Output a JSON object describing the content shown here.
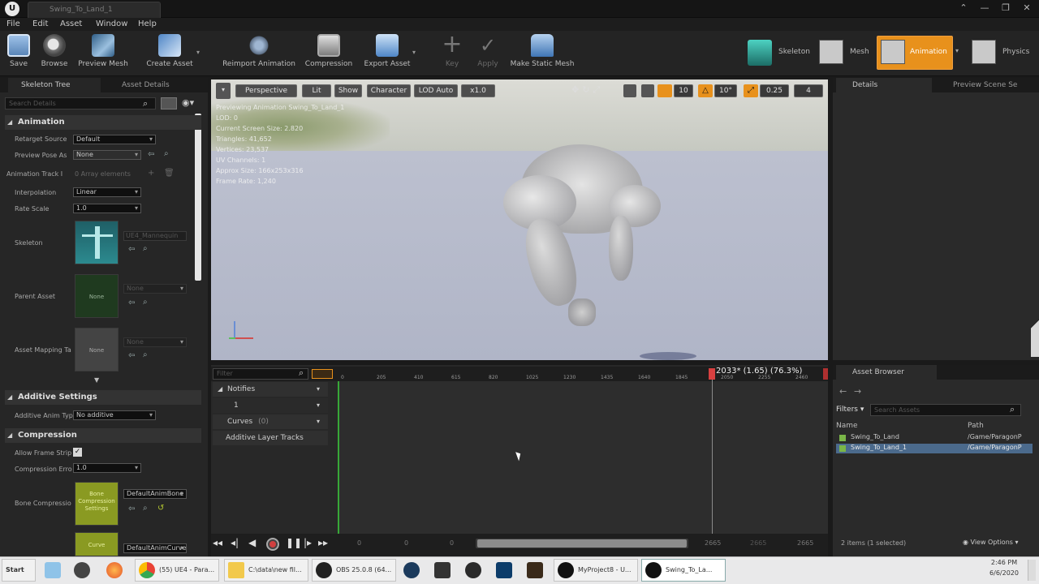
{
  "window": {
    "tab_title": "Swing_To_Land_1",
    "controls": [
      "⌃",
      "—",
      "❐",
      "✕"
    ]
  },
  "menu": [
    "File",
    "Edit",
    "Asset",
    "Window",
    "Help"
  ],
  "toolbar": {
    "buttons": [
      {
        "label": "Save",
        "icon": "save-icon"
      },
      {
        "label": "Browse",
        "icon": "browse-icon"
      },
      {
        "label": "Preview Mesh",
        "icon": "preview-mesh-icon"
      },
      {
        "label": "Create Asset",
        "icon": "create-asset-icon"
      },
      {
        "label": "Reimport Animation",
        "icon": "reimport-icon"
      },
      {
        "label": "Compression",
        "icon": "compression-icon"
      },
      {
        "label": "Export Asset",
        "icon": "export-icon"
      },
      {
        "label": "Key",
        "icon": "plus-icon"
      },
      {
        "label": "Apply",
        "icon": "check-icon"
      },
      {
        "label": "Make Static Mesh",
        "icon": "static-mesh-icon"
      }
    ],
    "modes": [
      "Skeleton",
      "Mesh",
      "Animation",
      "Physics"
    ]
  },
  "left_panel": {
    "tabs": [
      "Skeleton Tree",
      "Asset Details"
    ],
    "search_placeholder": "Search Details",
    "sections": {
      "animation": "Animation",
      "additive": "Additive Settings",
      "compression": "Compression"
    },
    "props": {
      "retarget_source": {
        "label": "Retarget Source",
        "value": "Default"
      },
      "preview_pose": {
        "label": "Preview Pose As",
        "value": "None"
      },
      "animation_track": {
        "label": "Animation Track I",
        "value": "0 Array elements"
      },
      "interpolation": {
        "label": "Interpolation",
        "value": "Linear"
      },
      "rate_scale": {
        "label": "Rate Scale",
        "value": "1.0"
      },
      "skeleton": {
        "label": "Skeleton",
        "value": "UE4_Mannequin"
      },
      "parent_asset": {
        "label": "Parent Asset",
        "value": "None",
        "thumb": "None"
      },
      "asset_mapping": {
        "label": "Asset Mapping Ta",
        "value": "None",
        "thumb": "None"
      },
      "additive_anim_type": {
        "label": "Additive Anim Typ",
        "value": "No additive"
      },
      "allow_frame_strip": {
        "label": "Allow Frame Strip",
        "checked": true
      },
      "compression_error": {
        "label": "Compression Erro",
        "value": "1.0"
      },
      "bone_compression": {
        "label": "Bone Compressio",
        "value": "DefaultAnimBone",
        "thumb": "Bone Compression Settings"
      },
      "curve": {
        "value": "DefaultAnimCurve",
        "thumb": "Curve"
      }
    }
  },
  "viewport": {
    "buttons": [
      "Perspective",
      "Lit",
      "Show",
      "Character",
      "LOD Auto",
      "x1.0"
    ],
    "snap_values": [
      "10",
      "10°",
      "0.25",
      "4"
    ],
    "stats": [
      "Previewing Animation Swing_To_Land_1",
      "LOD: 0",
      "Current Screen Size: 2.820",
      "Triangles: 41,652",
      "Vertices: 23,537",
      "UV Channels: 1",
      "Approx Size: 166x253x316",
      "Frame Rate: 1,240"
    ]
  },
  "timeline": {
    "filter_placeholder": "Filter",
    "tracks": [
      "Notifies",
      "1",
      "Curves",
      "Additive Layer Tracks"
    ],
    "curves_count": "(0)",
    "ticks": [
      "0",
      "205",
      "410",
      "615",
      "820",
      "1025",
      "1230",
      "1435",
      "1640",
      "1845",
      "2050",
      "2255",
      "2460"
    ],
    "playhead_readout": "2033* (1.65) (76.3%)",
    "playback_fraction": 0.763,
    "range": [
      "0",
      "0",
      "0",
      "2665",
      "2665",
      "2665"
    ]
  },
  "right_panel": {
    "tabs": [
      "Details",
      "Preview Scene Se"
    ]
  },
  "asset_browser": {
    "tab": "Asset Browser",
    "filters_label": "Filters",
    "search_placeholder": "Search Assets",
    "columns": [
      "Name",
      "Path"
    ],
    "rows": [
      {
        "name": "Swing_To_Land",
        "path": "/Game/ParagonP"
      },
      {
        "name": "Swing_To_Land_1",
        "path": "/Game/ParagonP"
      }
    ],
    "status": "2 items (1 selected)",
    "view_options": "View Options"
  },
  "taskbar": {
    "start": "Start",
    "items": [
      {
        "label": "",
        "icon": "pen-icon"
      },
      {
        "label": "",
        "icon": "gear-app-icon"
      },
      {
        "label": "",
        "icon": "firefox-icon"
      },
      {
        "label": "(55) UE4 - Para...",
        "icon": "chrome-icon"
      },
      {
        "label": "C:\\data\\new fil...",
        "icon": "folder-icon"
      },
      {
        "label": "OBS 25.0.8 (64...",
        "icon": "obs-icon"
      },
      {
        "label": "",
        "icon": "steam-icon"
      },
      {
        "label": "",
        "icon": "app-icon"
      },
      {
        "label": "",
        "icon": "circle-icon"
      },
      {
        "label": "",
        "icon": "photoshop-icon"
      },
      {
        "label": "",
        "icon": "wacom-icon"
      },
      {
        "label": "MyProject8 - U...",
        "icon": "unreal-icon"
      },
      {
        "label": "Swing_To_La...",
        "icon": "unreal-icon"
      }
    ],
    "time": "2:46 PM",
    "date": "6/6/2020"
  },
  "colors": {
    "accent_orange": "#e8911c",
    "selection_blue": "#4b6a8c"
  }
}
